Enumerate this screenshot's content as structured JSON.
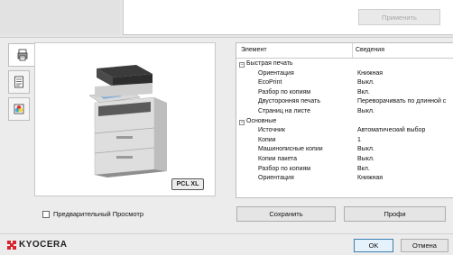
{
  "top": {
    "apply_label": "Применить"
  },
  "tabs": [
    {
      "icon": "printer-settings-icon"
    },
    {
      "icon": "document-list-icon"
    },
    {
      "icon": "color-icon"
    }
  ],
  "preview": {
    "device_icon": "multifunction-printer-image",
    "badge": "PCL XL",
    "checkbox_label": "Предварительный Просмотр",
    "checkbox_checked": false
  },
  "table": {
    "col_element": "Элемент",
    "col_details": "Сведения",
    "rows": [
      {
        "type": "group",
        "name": "Быстрая печать",
        "value": "",
        "toggle": "−"
      },
      {
        "type": "item",
        "name": "Ориентация",
        "value": "Книжная"
      },
      {
        "type": "item",
        "name": "EcoPrint",
        "value": "Выкл."
      },
      {
        "type": "item",
        "name": "Разбор по копиям",
        "value": "Вкл."
      },
      {
        "type": "item",
        "name": "Двусторонняя печать",
        "value": "Переворачивать по длинной с"
      },
      {
        "type": "item",
        "name": "Страниц на листе",
        "value": "Выкл."
      },
      {
        "type": "group",
        "name": "Основные",
        "value": "",
        "toggle": "−"
      },
      {
        "type": "item",
        "name": "Источник",
        "value": "Автоматический выбор"
      },
      {
        "type": "item",
        "name": "Копии",
        "value": "1"
      },
      {
        "type": "item",
        "name": "Машинописные копии",
        "value": "Выкл."
      },
      {
        "type": "item",
        "name": "Копии пакета",
        "value": "Выкл."
      },
      {
        "type": "item",
        "name": "Разбор по копиям",
        "value": "Вкл."
      },
      {
        "type": "item",
        "name": "Ориентация",
        "value": "Книжная"
      }
    ]
  },
  "buttons": {
    "save": "Сохранить",
    "profile": "Профи",
    "ok": "OK",
    "cancel": "Отмена"
  },
  "brand": {
    "logo_text": "KYOCERA",
    "logo_color": "#d9232e"
  }
}
